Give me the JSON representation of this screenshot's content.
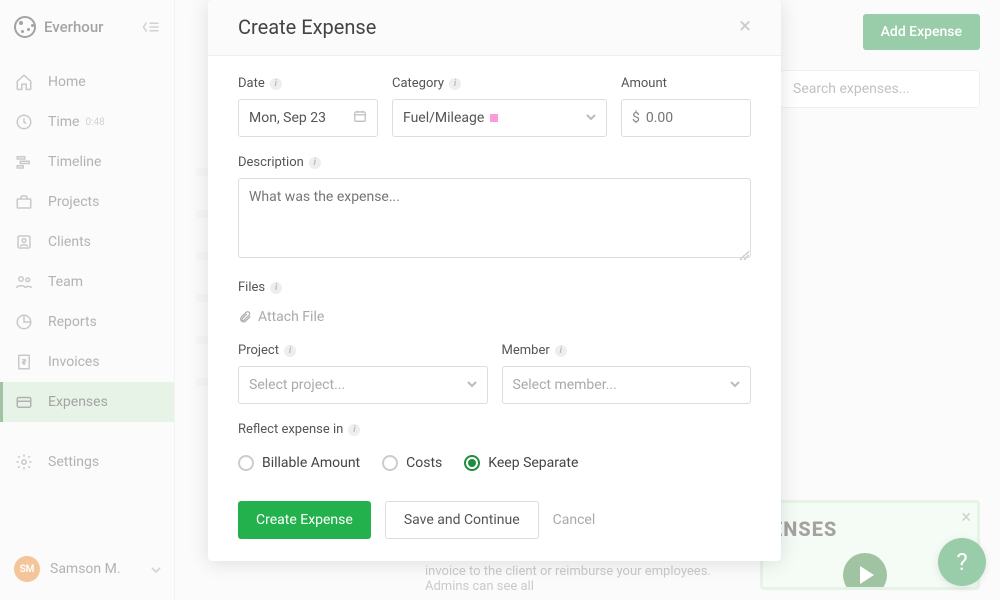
{
  "brand": {
    "name": "Everhour"
  },
  "sidebar": {
    "items": [
      {
        "label": "Home"
      },
      {
        "label": "Time",
        "badge": "0:48"
      },
      {
        "label": "Timeline"
      },
      {
        "label": "Projects"
      },
      {
        "label": "Clients"
      },
      {
        "label": "Team"
      },
      {
        "label": "Reports"
      },
      {
        "label": "Invoices"
      },
      {
        "label": "Expenses"
      }
    ],
    "settings_label": "Settings"
  },
  "user": {
    "initials": "SM",
    "name": "Samson M."
  },
  "topbar": {
    "add_expense": "Add Expense",
    "search_placeholder": "Search expenses..."
  },
  "background_hint": "invoice to the client or reimburse your employees. Admins can see all",
  "promo": {
    "title": "ENSES"
  },
  "modal": {
    "title": "Create Expense",
    "fields": {
      "date_label": "Date",
      "date_value": "Mon, Sep 23",
      "category_label": "Category",
      "category_value": "Fuel/Mileage",
      "amount_label": "Amount",
      "amount_prefix": "$",
      "amount_placeholder": "0.00",
      "description_label": "Description",
      "description_placeholder": "What was the expense...",
      "files_label": "Files",
      "attach_label": "Attach File",
      "project_label": "Project",
      "project_placeholder": "Select project...",
      "member_label": "Member",
      "member_placeholder": "Select member...",
      "reflect_label": "Reflect expense in",
      "reflect_options": [
        "Billable Amount",
        "Costs",
        "Keep Separate"
      ],
      "reflect_selected": 2
    },
    "actions": {
      "create": "Create Expense",
      "save_continue": "Save and Continue",
      "cancel": "Cancel"
    }
  },
  "help": "?"
}
